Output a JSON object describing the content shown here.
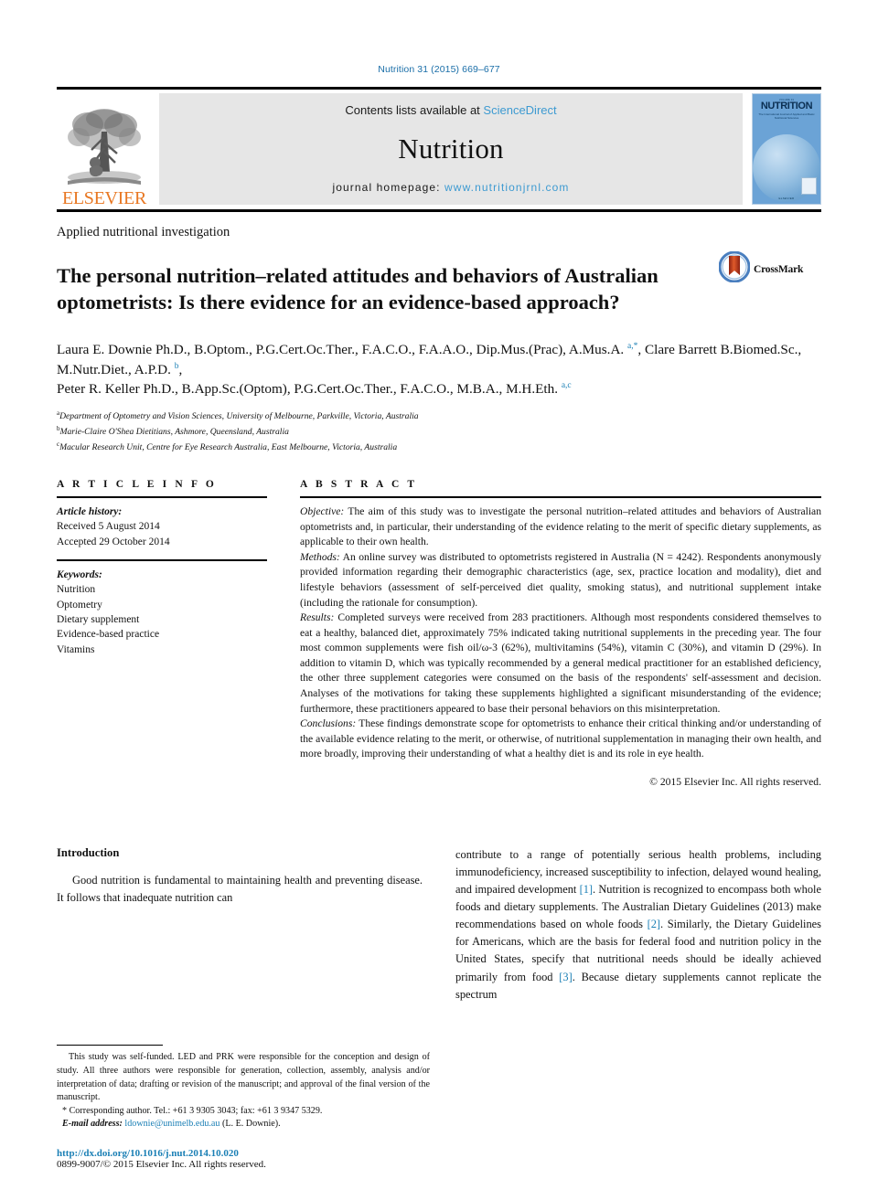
{
  "running_head": "Nutrition 31 (2015) 669–677",
  "masthead": {
    "publisher_name": "ELSEVIER",
    "contents_prefix": "Contents lists available at",
    "contents_link": "ScienceDirect",
    "journal_name": "Nutrition",
    "homepage_prefix": "journal homepage:",
    "homepage_url": "www.nutritionjrnl.com",
    "cover": {
      "volume_line": "VOLUME 31",
      "title": "NUTRITION",
      "subtitle": "The International Journal of Applied and Basic Nutritional Sciences",
      "footer": "ELSEVIER"
    },
    "link_color": "#3d9ad1",
    "elsevier_color": "#e87722"
  },
  "article": {
    "kicker": "Applied nutritional investigation",
    "title": "The personal nutrition–related attitudes and behaviors of Australian optometrists: Is there evidence for an evidence-based approach?",
    "crossmark_label": "CrossMark",
    "authors_html": "Laura E. Downie Ph.D., B.Optom., P.G.Cert.Oc.Ther., F.A.C.O., F.A.A.O., Dip.Mus.(Prac), A.Mus.A. <sup>a,*</sup>, Clare Barrett B.Biomed.Sc., M.Nutr.Diet., A.P.D. <sup>b</sup>,<br>Peter R. Keller Ph.D., B.App.Sc.(Optom), P.G.Cert.Oc.Ther., F.A.C.O., M.B.A., M.H.Eth. <sup>a,c</sup>",
    "affiliations": [
      {
        "marker": "a",
        "text": "Department of Optometry and Vision Sciences, University of Melbourne, Parkville, Victoria, Australia"
      },
      {
        "marker": "b",
        "text": "Marie-Claire O'Shea Dietitians, Ashmore, Queensland, Australia"
      },
      {
        "marker": "c",
        "text": "Macular Research Unit, Centre for Eye Research Australia, East Melbourne, Victoria, Australia"
      }
    ]
  },
  "article_info": {
    "heading": "A R T I C L E   I N F O",
    "history_label": "Article history:",
    "history": [
      "Received 5 August 2014",
      "Accepted 29 October 2014"
    ],
    "keywords_label": "Keywords:",
    "keywords": [
      "Nutrition",
      "Optometry",
      "Dietary supplement",
      "Evidence-based practice",
      "Vitamins"
    ]
  },
  "abstract": {
    "heading": "A B S T R A C T",
    "sections": [
      {
        "label": "Objective:",
        "text": " The aim of this study was to investigate the personal nutrition–related attitudes and behaviors of Australian optometrists and, in particular, their understanding of the evidence relating to the merit of specific dietary supplements, as applicable to their own health."
      },
      {
        "label": "Methods:",
        "text": " An online survey was distributed to optometrists registered in Australia (N = 4242). Respondents anonymously provided information regarding their demographic characteristics (age, sex, practice location and modality), diet and lifestyle behaviors (assessment of self-perceived diet quality, smoking status), and nutritional supplement intake (including the rationale for consumption)."
      },
      {
        "label": "Results:",
        "text": " Completed surveys were received from 283 practitioners. Although most respondents considered themselves to eat a healthy, balanced diet, approximately 75% indicated taking nutritional supplements in the preceding year. The four most common supplements were fish oil/ω-3 (62%), multivitamins (54%), vitamin C (30%), and vitamin D (29%). In addition to vitamin D, which was typically recommended by a general medical practitioner for an established deficiency, the other three supplement categories were consumed on the basis of the respondents' self-assessment and decision. Analyses of the motivations for taking these supplements highlighted a significant misunderstanding of the evidence; furthermore, these practitioners appeared to base their personal behaviors on this misinterpretation."
      },
      {
        "label": "Conclusions:",
        "text": " These findings demonstrate scope for optometrists to enhance their critical thinking and/or understanding of the available evidence relating to the merit, or otherwise, of nutritional supplementation in managing their own health, and more broadly, improving their understanding of what a healthy diet is and its role in eye health."
      }
    ],
    "copyright": "© 2015 Elsevier Inc. All rights reserved."
  },
  "body": {
    "intro_heading": "Introduction",
    "left_paragraph": "Good nutrition is fundamental to maintaining health and preventing disease. It follows that inadequate nutrition can",
    "right_paragraph_parts": [
      "contribute to a range of potentially serious health problems, including immunodeficiency, increased susceptibility to infection, delayed wound healing, and impaired development ",
      "[1]",
      ". Nutrition is recognized to encompass both whole foods and dietary supplements. The Australian Dietary Guidelines (2013) make recommendations based on whole foods ",
      "[2]",
      ". Similarly, the Dietary Guidelines for Americans, which are the basis for federal food and nutrition policy in the United States, specify that nutritional needs should be ideally achieved primarily from food ",
      "[3]",
      ". Because dietary supplements cannot replicate the spectrum"
    ]
  },
  "footnotes": {
    "funding": "This study was self-funded. LED and PRK were responsible for the conception and design of study. All three authors were responsible for generation, collection, assembly, analysis and/or interpretation of data; drafting or revision of the manuscript; and approval of the final version of the manuscript.",
    "corresponding": "* Corresponding author. Tel.: +61 3 9305 3043; fax: +61 3 9347 5329.",
    "email_label": "E-mail address:",
    "email": "ldownie@unimelb.edu.au",
    "email_suffix": " (L. E. Downie).",
    "doi": "http://dx.doi.org/10.1016/j.nut.2014.10.020",
    "issn": "0899-9007/© 2015 Elsevier Inc. All rights reserved."
  }
}
